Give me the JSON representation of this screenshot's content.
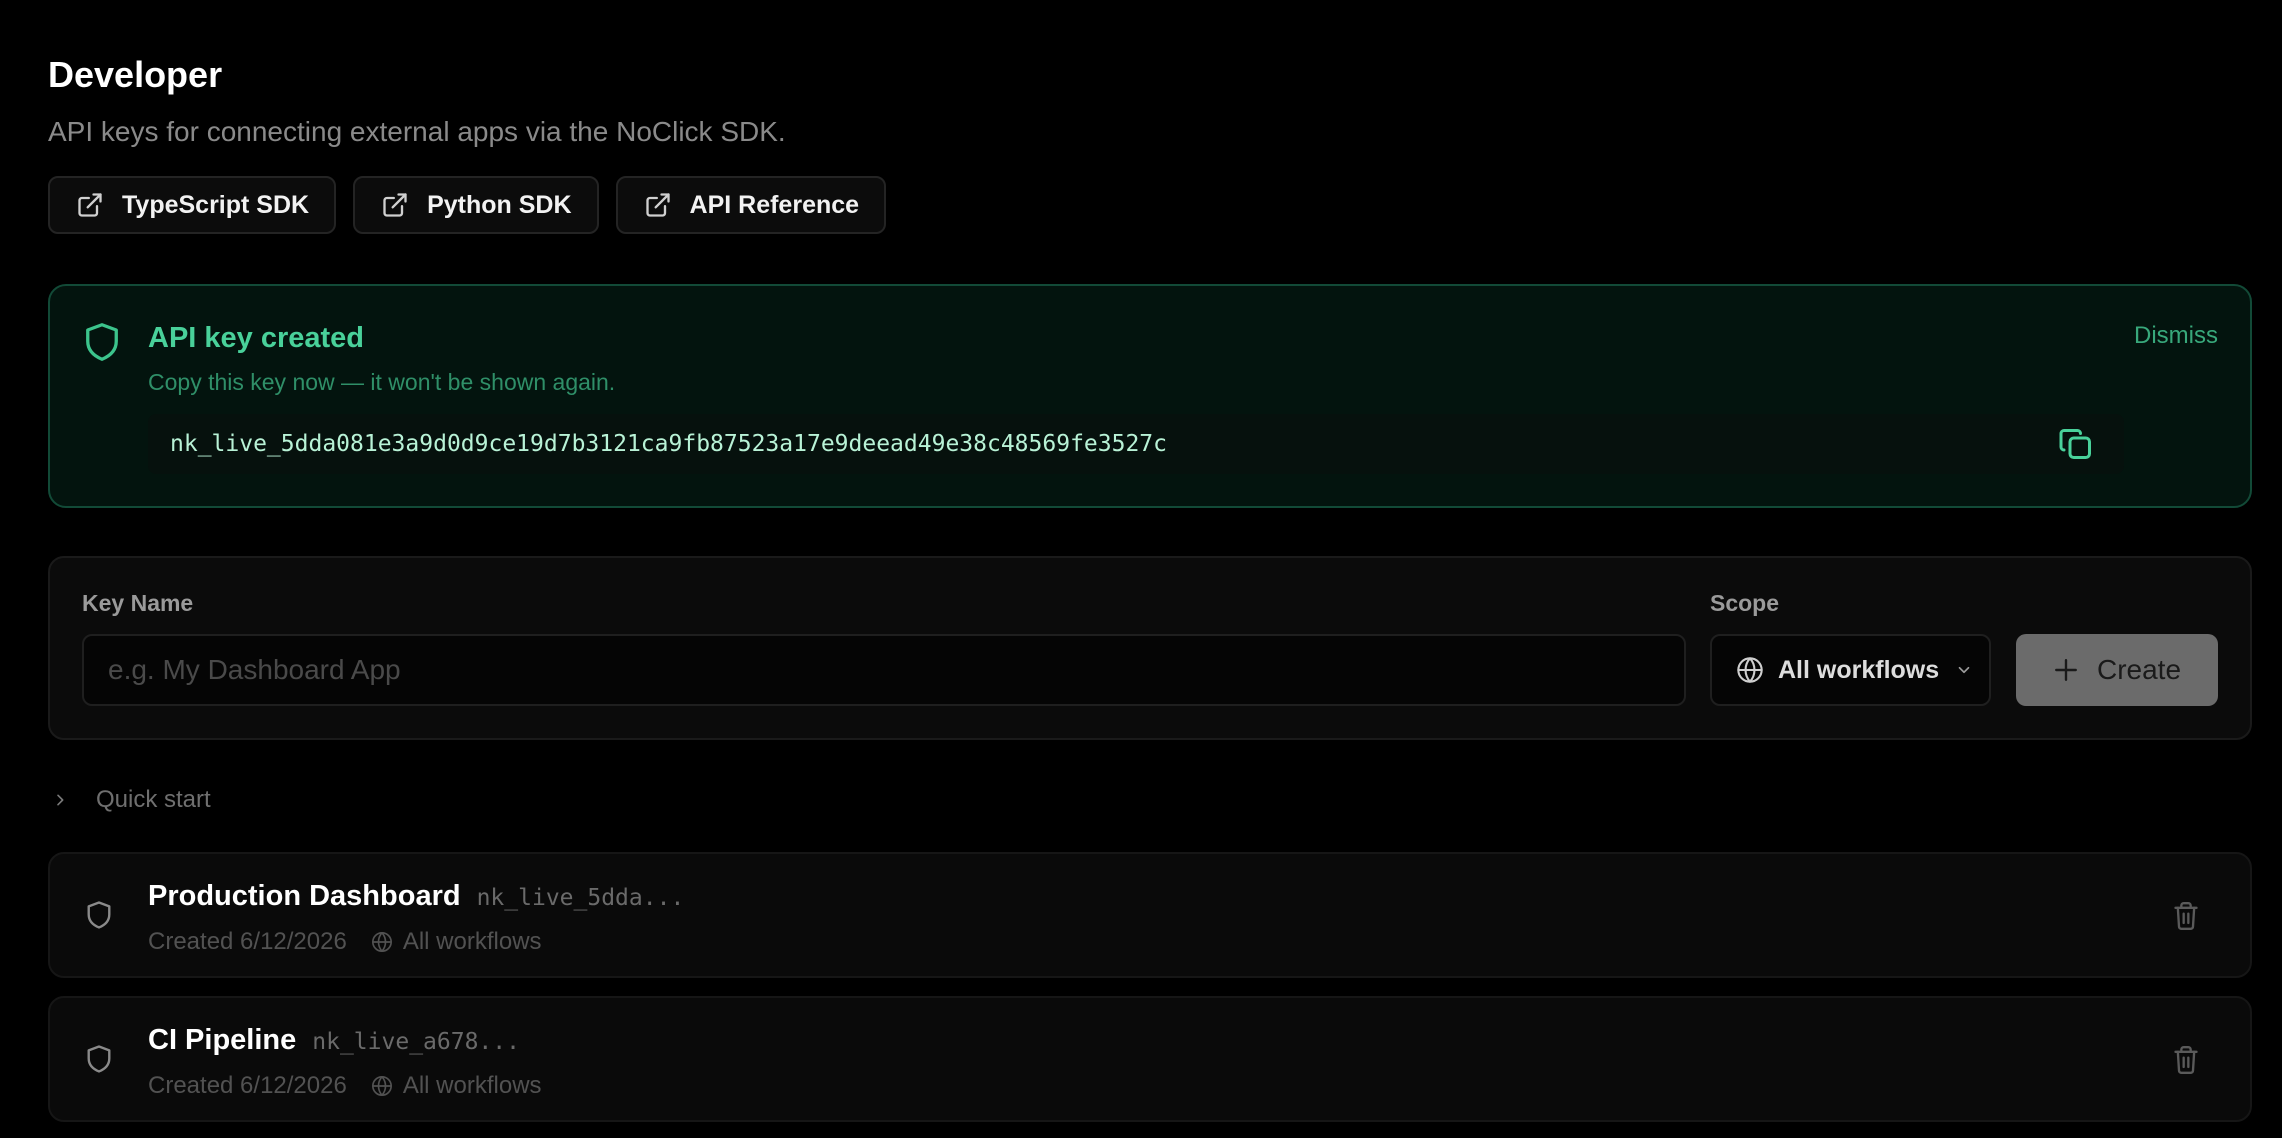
{
  "header": {
    "title": "Developer",
    "subtitle": "API keys for connecting external apps via the NoClick SDK."
  },
  "links": [
    {
      "label": "TypeScript SDK",
      "icon": "external-link-icon"
    },
    {
      "label": "Python SDK",
      "icon": "external-link-icon"
    },
    {
      "label": "API Reference",
      "icon": "external-link-icon"
    }
  ],
  "banner": {
    "title": "API key created",
    "subtitle": "Copy this key now — it won't be shown again.",
    "dismiss_label": "Dismiss",
    "key": "nk_live_5dda081e3a9d0d9ce19d7b3121ca9fb87523a17e9deead49e38c48569fe3527c",
    "icon": "shield-icon",
    "accent": "#49d19a"
  },
  "form": {
    "name_label": "Key Name",
    "name_placeholder": "e.g. My Dashboard App",
    "name_value": "",
    "scope_label": "Scope",
    "scope_value": "All workflows",
    "create_label": "Create"
  },
  "quick_start": {
    "label": "Quick start",
    "expanded": false
  },
  "keys": [
    {
      "name": "Production Dashboard",
      "prefix": "nk_live_5dda...",
      "created": "Created 6/12/2026",
      "scope": "All workflows"
    },
    {
      "name": "CI Pipeline",
      "prefix": "nk_live_a678...",
      "created": "Created 6/12/2026",
      "scope": "All workflows"
    }
  ]
}
